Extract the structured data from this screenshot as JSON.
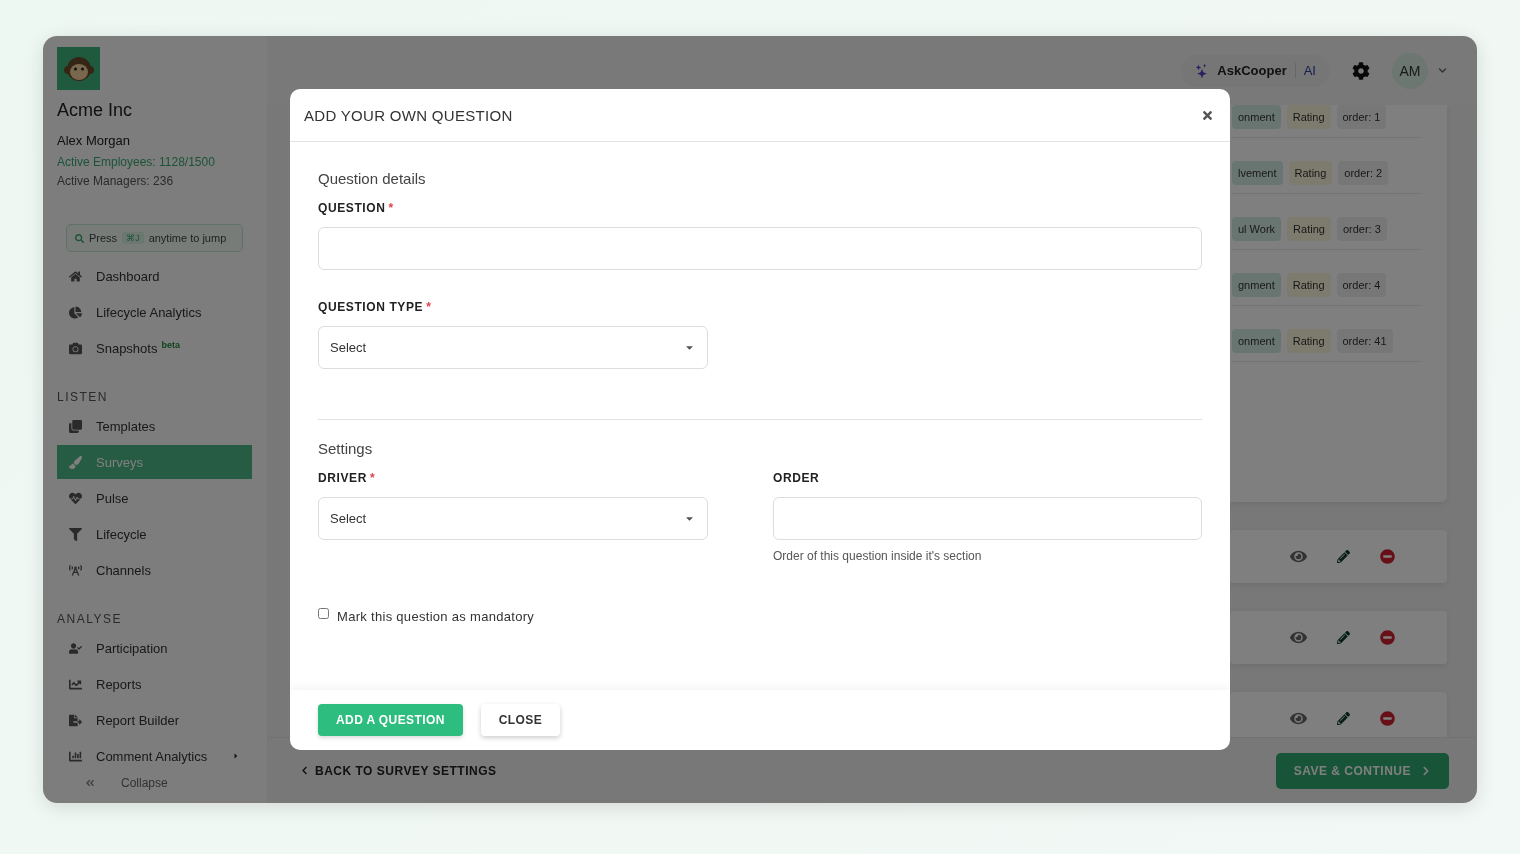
{
  "sidebar": {
    "company": "Acme Inc",
    "user": "Alex Morgan",
    "employees": "Active Employees: 1128/1500",
    "managers": "Active Managers: 236",
    "jump": {
      "prefix": "Press",
      "key": "⌘J",
      "suffix": "anytime to jump"
    },
    "top_items": [
      {
        "label": "Dashboard",
        "selected": false
      },
      {
        "label": "Lifecycle Analytics",
        "selected": false
      },
      {
        "label": "Snapshots",
        "badge": "beta",
        "selected": false
      }
    ],
    "sections": [
      {
        "heading": "LISTEN",
        "items": [
          {
            "label": "Templates",
            "selected": false
          },
          {
            "label": "Surveys",
            "selected": true
          },
          {
            "label": "Pulse",
            "selected": false
          },
          {
            "label": "Lifecycle",
            "selected": false
          },
          {
            "label": "Channels",
            "selected": false
          }
        ]
      },
      {
        "heading": "ANALYSE",
        "items": [
          {
            "label": "Participation",
            "selected": false
          },
          {
            "label": "Reports",
            "selected": false
          },
          {
            "label": "Report Builder",
            "selected": false
          },
          {
            "label": "Comment Analytics",
            "expandable": true,
            "selected": false
          }
        ]
      }
    ],
    "collapse": "Collapse"
  },
  "header": {
    "assistant": "AskCooper",
    "assistant_tag": "AI",
    "avatar": "AM"
  },
  "questions": [
    {
      "driver": "onment",
      "type": "Rating",
      "order": "order: 1"
    },
    {
      "driver": "lvement",
      "type": "Rating",
      "order": "order: 2"
    },
    {
      "driver": "ul Work",
      "type": "Rating",
      "order": "order: 3"
    },
    {
      "driver": "gnment",
      "type": "Rating",
      "order": "order: 4"
    },
    {
      "driver": "onment",
      "type": "Rating",
      "order": "order: 41"
    }
  ],
  "footer": {
    "back": "BACK TO SURVEY SETTINGS",
    "save": "SAVE & CONTINUE"
  },
  "modal": {
    "title": "ADD YOUR OWN QUESTION",
    "details_heading": "Question details",
    "question": {
      "label": "QUESTION",
      "required_mark": "*"
    },
    "question_type": {
      "label": "QUESTION TYPE",
      "required_mark": "*",
      "placeholder": "Select"
    },
    "settings_heading": "Settings",
    "driver": {
      "label": "DRIVER",
      "required_mark": "*",
      "placeholder": "Select"
    },
    "order": {
      "label": "ORDER",
      "help": "Order of this question inside it's section"
    },
    "mandatory": {
      "label": "Mark this question as mandatory",
      "checked": false
    },
    "add_button": "ADD A QUESTION",
    "close_button": "CLOSE"
  }
}
